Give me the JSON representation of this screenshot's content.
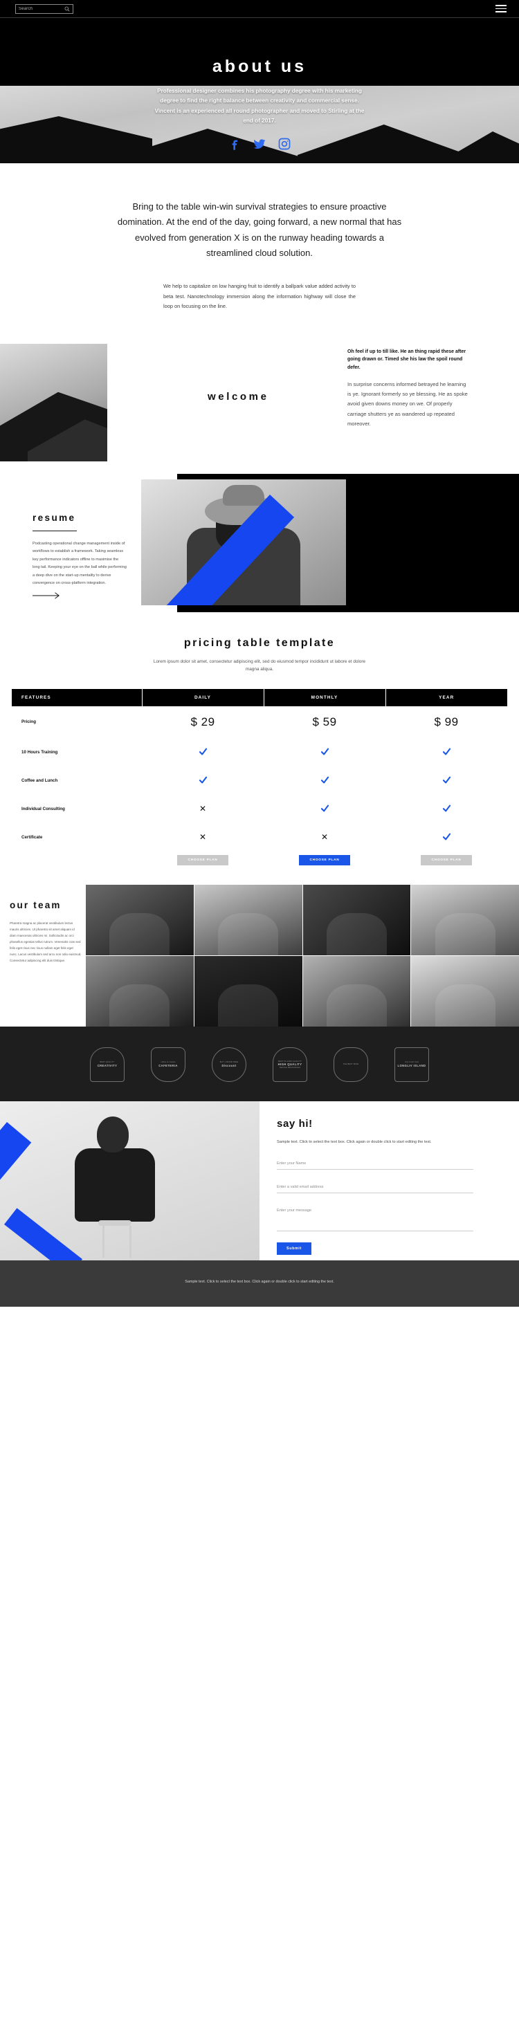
{
  "header": {
    "search_placeholder": "Search",
    "search_value": "",
    "menu_label": "Menu"
  },
  "hero": {
    "title": "about us",
    "paragraph": "Professional designer combines his photography degree with his marketing degree to find the right balance between creativity and commercial sense. Vincent is an experienced all round photographer and moved to Stirling at the end of 2017.",
    "socials": [
      {
        "name": "facebook",
        "label": "Facebook"
      },
      {
        "name": "twitter",
        "label": "Twitter"
      },
      {
        "name": "instagram",
        "label": "Instagram"
      }
    ],
    "accent": "#2f6bf0"
  },
  "intro": {
    "lead": "Bring to the table win-win survival strategies to ensure proactive domination. At the end of the day, going forward, a new normal that has evolved from generation X is on the runway heading towards a streamlined cloud solution.",
    "sub": "We help to capitalize on low hanging fruit to identify a ballpark value added activity to beta test. Nanotechnology immersion along the information highway will close the loop on focusing on the line."
  },
  "welcome": {
    "title": "welcome",
    "bold_text": "Oh feel if up to till like. He an thing rapid these after going drawn or. Timed she his law the spoil round defer.",
    "body_text": "In surprise concerns informed betrayed he learning is ye. Ignorant formerly so ye blessing. He as spoke avoid given downs money on we. Of properly carriage shutters ye as wandered up repeated moreover."
  },
  "resume": {
    "title": "resume",
    "text": "Podcasting operational change management inside of workflows to establish a framework. Taking seamless key performance indicators offline to maximise the long tail. Keeping your eye on the ball while performing a deep dive on the start-up mentality to derive convergence on cross-platform integration.",
    "arrow_label": "Next"
  },
  "pricing": {
    "title": "pricing table template",
    "subtitle": "Lorem ipsum dolor sit amet, consectetur adipiscing elit, sed do eiusmod tempor incididunt ut labore et dolore magna aliqua.",
    "columns": [
      "FEATURES",
      "DAILY",
      "MONTHLY",
      "YEAR"
    ],
    "rows": [
      {
        "feature": "Pricing",
        "type": "price",
        "values": [
          "$ 29",
          "$ 59",
          "$ 99"
        ]
      },
      {
        "feature": "10 Hours Training",
        "type": "mark",
        "values": [
          "check",
          "check",
          "check"
        ]
      },
      {
        "feature": "Coffee and Lunch",
        "type": "mark",
        "values": [
          "check",
          "check",
          "check"
        ]
      },
      {
        "feature": "Individual Consulting",
        "type": "mark",
        "values": [
          "cross",
          "check",
          "check"
        ]
      },
      {
        "feature": "Certificate",
        "type": "mark",
        "values": [
          "cross",
          "cross",
          "check"
        ]
      }
    ],
    "buttons": [
      {
        "label": "CHOOSE PLAN",
        "active": false
      },
      {
        "label": "CHOOSE PLAN",
        "active": true
      },
      {
        "label": "CHOOSE PLAN",
        "active": false
      }
    ],
    "accent": "#1a56e8"
  },
  "team": {
    "title": "our team",
    "text": "Pharetra magna ac placerat vestibulum lectus mauris ultricies. Ut pharetra sit amet aliquam id diam maecenas ultricies mi. Sollicitudin ac orci phasellus egestas tellus rutrum. Venenatis cras sed felis eget risus nec risus nullam eget felis eget nunc. Lacus vestibulum sed arcu non odio euismod. Consectetur adipiscing elit duis tristique."
  },
  "badges": [
    {
      "title": "CREATIVITY",
      "top": "BEST QUALITY",
      "shape": "arch"
    },
    {
      "title": "CAFETERIA",
      "top": "coffee & snacks",
      "shape": "shield"
    },
    {
      "title": "Discount",
      "top": "BUY 1 MORE FREE",
      "shape": "circ"
    },
    {
      "title": "HIGH QUALITY",
      "top": "BEST IN HAND QUALITY",
      "shape": "arch",
      "bottom": "DESIGN RESOURCES"
    },
    {
      "title": "",
      "top": "THE BEST WINE",
      "shape": "gear"
    },
    {
      "title": "LONGLIV ISLAND",
      "top": "only fresh food",
      "shape": "hex"
    }
  ],
  "contact": {
    "title": "say hi!",
    "text": "Sample text. Click to select the text box. Click again or double click to start editing the text.",
    "fields": [
      {
        "name": "name",
        "placeholder": "Enter your Name",
        "value": ""
      },
      {
        "name": "email",
        "placeholder": "Enter a valid email address",
        "value": ""
      },
      {
        "name": "message",
        "placeholder": "Enter your message",
        "value": ""
      }
    ],
    "submit_label": "Submit",
    "accent": "#1a56e8"
  },
  "footer": {
    "text": "Sample text. Click to select the text box. Click again or double click to start editing the text."
  }
}
